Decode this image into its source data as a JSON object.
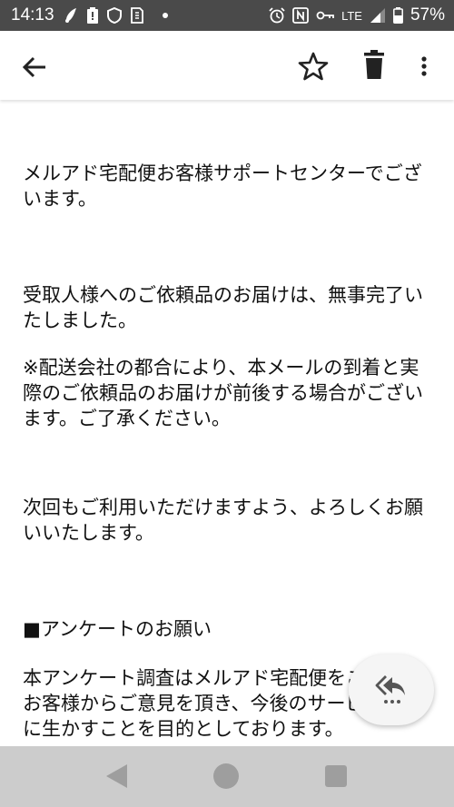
{
  "status_bar": {
    "time": "14:13",
    "network": "LTE",
    "battery": "57%",
    "icons": [
      "notification-icon",
      "battery-alert-icon",
      "shield-icon",
      "sim-icon",
      "dot-icon",
      "alarm-icon",
      "nfc-icon",
      "vpn-key-icon",
      "signal-icon",
      "battery-icon"
    ]
  },
  "app_bar": {
    "icons": [
      "back-arrow-icon",
      "star-icon",
      "trash-icon",
      "more-vert-icon"
    ]
  },
  "email": {
    "paragraphs": [
      "メルアド宅配便お客様サポートセンターでございます。",
      "受取人様へのご依頼品のお届けは、無事完了いたしました。",
      "※配送会社の都合により、本メールの到着と実際のご依頼品のお届けが前後する場合がございます。ご了承ください。",
      "次回もご利用いただけますよう、よろしくお願いいたします。",
      "■アンケートのお願い",
      "本アンケート調査はメルアド宅配便をご利用のお客様からご意見を頂き、今後のサービス向上に生かすことを目的としております。"
    ]
  },
  "fab": {
    "icon": "reply-all-icon"
  },
  "nav_bar": {
    "icons": [
      "nav-back-icon",
      "nav-home-icon",
      "nav-recent-icon"
    ]
  }
}
